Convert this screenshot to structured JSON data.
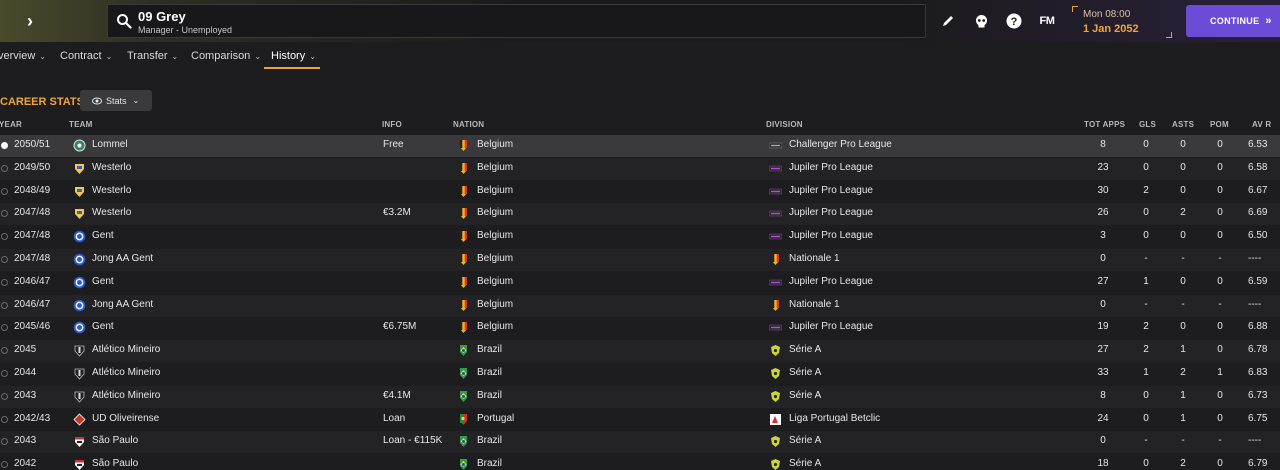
{
  "header": {
    "name": "09 Grey",
    "subtitle": "Manager - Unemployed",
    "time": "Mon 08:00",
    "date": "1 Jan 2052",
    "continue_label": "CONTINUE",
    "fm_logo": "FM"
  },
  "tabs": [
    {
      "label": "verview"
    },
    {
      "label": "Contract"
    },
    {
      "label": "Transfer"
    },
    {
      "label": "Comparison"
    },
    {
      "label": "History"
    }
  ],
  "section": {
    "title": "CAREER STATS",
    "stats_label": "Stats"
  },
  "columns": {
    "year": "YEAR",
    "team": "TEAM",
    "info": "INFO",
    "nation": "NATION",
    "division": "DIVISION",
    "apps": "TOT APPS",
    "gls": "GLS",
    "asts": "ASTS",
    "pom": "POM",
    "avr": "AV R"
  },
  "colors": {
    "accent": "#f0a53a",
    "continue": "#6a4cd6"
  },
  "rows": [
    {
      "year": "2050/51",
      "team": "Lommel",
      "team_icon": "lommel-crest-icon",
      "info": "Free",
      "nation": "Belgium",
      "division": "Challenger Pro League",
      "div_icon": "cpl-icon",
      "apps": "8",
      "gls": "0",
      "asts": "0",
      "pom": "0",
      "avr": "6.53"
    },
    {
      "year": "2049/50",
      "team": "Westerlo",
      "team_icon": "westerlo-crest-icon",
      "info": "",
      "nation": "Belgium",
      "division": "Jupiler Pro League",
      "div_icon": "jpl-icon",
      "apps": "23",
      "gls": "0",
      "asts": "0",
      "pom": "0",
      "avr": "6.58"
    },
    {
      "year": "2048/49",
      "team": "Westerlo",
      "team_icon": "westerlo-crest-icon",
      "info": "",
      "nation": "Belgium",
      "division": "Jupiler Pro League",
      "div_icon": "jpl-icon",
      "apps": "30",
      "gls": "2",
      "asts": "0",
      "pom": "0",
      "avr": "6.67"
    },
    {
      "year": "2047/48",
      "team": "Westerlo",
      "team_icon": "westerlo-crest-icon",
      "info": "€3.2M",
      "nation": "Belgium",
      "division": "Jupiler Pro League",
      "div_icon": "jpl-icon",
      "apps": "26",
      "gls": "0",
      "asts": "2",
      "pom": "0",
      "avr": "6.69"
    },
    {
      "year": "2047/48",
      "team": "Gent",
      "team_icon": "gent-crest-icon",
      "info": "",
      "nation": "Belgium",
      "division": "Jupiler Pro League",
      "div_icon": "jpl-icon",
      "apps": "3",
      "gls": "0",
      "asts": "0",
      "pom": "0",
      "avr": "6.50"
    },
    {
      "year": "2047/48",
      "team": "Jong AA Gent",
      "team_icon": "gent-crest-icon",
      "info": "",
      "nation": "Belgium",
      "division": "Nationale 1",
      "div_icon": "nationale-icon",
      "apps": "0",
      "gls": "-",
      "asts": "-",
      "pom": "-",
      "avr": "----"
    },
    {
      "year": "2046/47",
      "team": "Gent",
      "team_icon": "gent-crest-icon",
      "info": "",
      "nation": "Belgium",
      "division": "Jupiler Pro League",
      "div_icon": "jpl-icon",
      "apps": "27",
      "gls": "1",
      "asts": "0",
      "pom": "0",
      "avr": "6.59"
    },
    {
      "year": "2046/47",
      "team": "Jong AA Gent",
      "team_icon": "gent-crest-icon",
      "info": "",
      "nation": "Belgium",
      "division": "Nationale 1",
      "div_icon": "nationale-icon",
      "apps": "0",
      "gls": "-",
      "asts": "-",
      "pom": "-",
      "avr": "----"
    },
    {
      "year": "2045/46",
      "team": "Gent",
      "team_icon": "gent-crest-icon",
      "info": "€6.75M",
      "nation": "Belgium",
      "division": "Jupiler Pro League",
      "div_icon": "jpl-icon",
      "apps": "19",
      "gls": "2",
      "asts": "0",
      "pom": "0",
      "avr": "6.88"
    },
    {
      "year": "2045",
      "team": "Atlético Mineiro",
      "team_icon": "mineiro-crest-icon",
      "info": "",
      "nation": "Brazil",
      "division": "Série A",
      "div_icon": "serie-a-icon",
      "apps": "27",
      "gls": "2",
      "asts": "1",
      "pom": "0",
      "avr": "6.78"
    },
    {
      "year": "2044",
      "team": "Atlético Mineiro",
      "team_icon": "mineiro-crest-icon",
      "info": "",
      "nation": "Brazil",
      "division": "Série A",
      "div_icon": "serie-a-icon",
      "apps": "33",
      "gls": "1",
      "asts": "2",
      "pom": "1",
      "avr": "6.83"
    },
    {
      "year": "2043",
      "team": "Atlético Mineiro",
      "team_icon": "mineiro-crest-icon",
      "info": "€4.1M",
      "nation": "Brazil",
      "division": "Série A",
      "div_icon": "serie-a-icon",
      "apps": "8",
      "gls": "0",
      "asts": "1",
      "pom": "0",
      "avr": "6.73"
    },
    {
      "year": "2042/43",
      "team": "UD Oliveirense",
      "team_icon": "oliveirense-crest-icon",
      "info": "Loan",
      "nation": "Portugal",
      "division": "Liga Portugal Betclic",
      "div_icon": "liga-portugal-icon",
      "apps": "24",
      "gls": "0",
      "asts": "1",
      "pom": "0",
      "avr": "6.75"
    },
    {
      "year": "2043",
      "team": "São Paulo",
      "team_icon": "sao-paulo-crest-icon",
      "info": "Loan - €115K",
      "nation": "Brazil",
      "division": "Série A",
      "div_icon": "serie-a-icon",
      "apps": "0",
      "gls": "-",
      "asts": "-",
      "pom": "-",
      "avr": "----"
    },
    {
      "year": "2042",
      "team": "São Paulo",
      "team_icon": "sao-paulo-crest-icon",
      "info": "",
      "nation": "Brazil",
      "division": "Série A",
      "div_icon": "serie-a-icon",
      "apps": "18",
      "gls": "0",
      "asts": "2",
      "pom": "0",
      "avr": "6.79"
    }
  ]
}
